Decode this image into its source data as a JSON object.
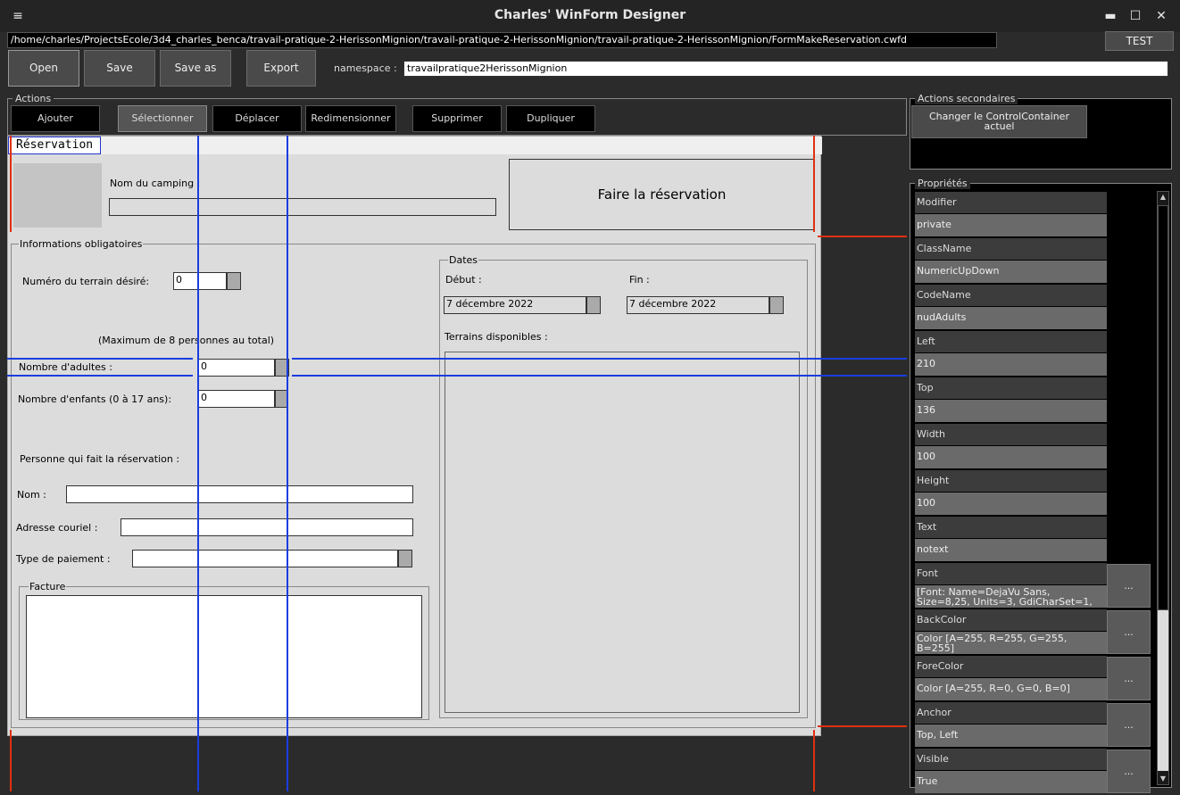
{
  "window": {
    "title": "Charles' WinForm Designer",
    "menu_glyph": "≡",
    "min_glyph": "▬",
    "max_glyph": "☐",
    "close_glyph": "✕"
  },
  "path": "/home/charles/ProjectsEcole/3d4_charles_benca/travail-pratique-2-HerissonMignion/travail-pratique-2-HerissonMignion/travail-pratique-2-HerissonMignion/FormMakeReservation.cwfd",
  "test_label": "TEST",
  "toolbar": {
    "open": "Open",
    "save": "Save",
    "save_as": "Save as",
    "export": "Export",
    "namespace_label": "namespace :",
    "namespace_value": "travailpratique2HerissonMignion"
  },
  "actions": {
    "title": "Actions",
    "buttons": [
      "Ajouter",
      "Sélectionner",
      "Déplacer",
      "Redimensionner",
      "Supprimer",
      "Dupliquer"
    ],
    "selected": "Sélectionner"
  },
  "secondary": {
    "title": "Actions secondaires",
    "button": "Changer le ControlContainer actuel"
  },
  "properties": {
    "title": "Propriétés",
    "ellipsis": "...",
    "items": [
      {
        "name": "Modifier",
        "value": "private"
      },
      {
        "name": "ClassName",
        "value": "NumericUpDown"
      },
      {
        "name": "CodeName",
        "value": "nudAdults"
      },
      {
        "name": "Left",
        "value": "210"
      },
      {
        "name": "Top",
        "value": "136"
      },
      {
        "name": "Width",
        "value": "100"
      },
      {
        "name": "Height",
        "value": "100"
      },
      {
        "name": "Text",
        "value": "notext"
      },
      {
        "name": "Font",
        "value": "[Font: Name=DejaVu Sans, Size=8,25, Units=3, GdiCharSet=1,"
      },
      {
        "name": "BackColor",
        "value": "Color [A=255, R=255, G=255, B=255]"
      },
      {
        "name": "ForeColor",
        "value": "Color [A=255, R=0, G=0, B=0]"
      },
      {
        "name": "Anchor",
        "value": "Top, Left"
      },
      {
        "name": "Visible",
        "value": "True"
      }
    ]
  },
  "form": {
    "title": "Réservation",
    "camping_label": "Nom du camping :",
    "reserve_button": "Faire la réservation",
    "info_group": "Informations obligatoires",
    "terrain_label": "Numéro du terrain désiré:",
    "terrain_value": "0",
    "max_note": "(Maximum de 8 personnes au total)",
    "adults_label": "Nombre d'adultes :",
    "adults_value": "0",
    "children_label": "Nombre d'enfants (0 à 17 ans):",
    "children_value": "0",
    "person_label": "Personne qui fait la réservation :",
    "nom_label": "Nom :",
    "email_label": "Adresse couriel :",
    "payment_label": "Type de paiement :",
    "facture_group": "Facture",
    "dates_group": "Dates",
    "start_label": "Début :",
    "start_value": "7 décembre 2022",
    "end_label": "Fin :",
    "end_value": "7 décembre 2022",
    "terrains_label": "Terrains disponibles :"
  },
  "colors": {
    "accent_selection": "#1a3de0",
    "anchor_line": "#e03010"
  }
}
